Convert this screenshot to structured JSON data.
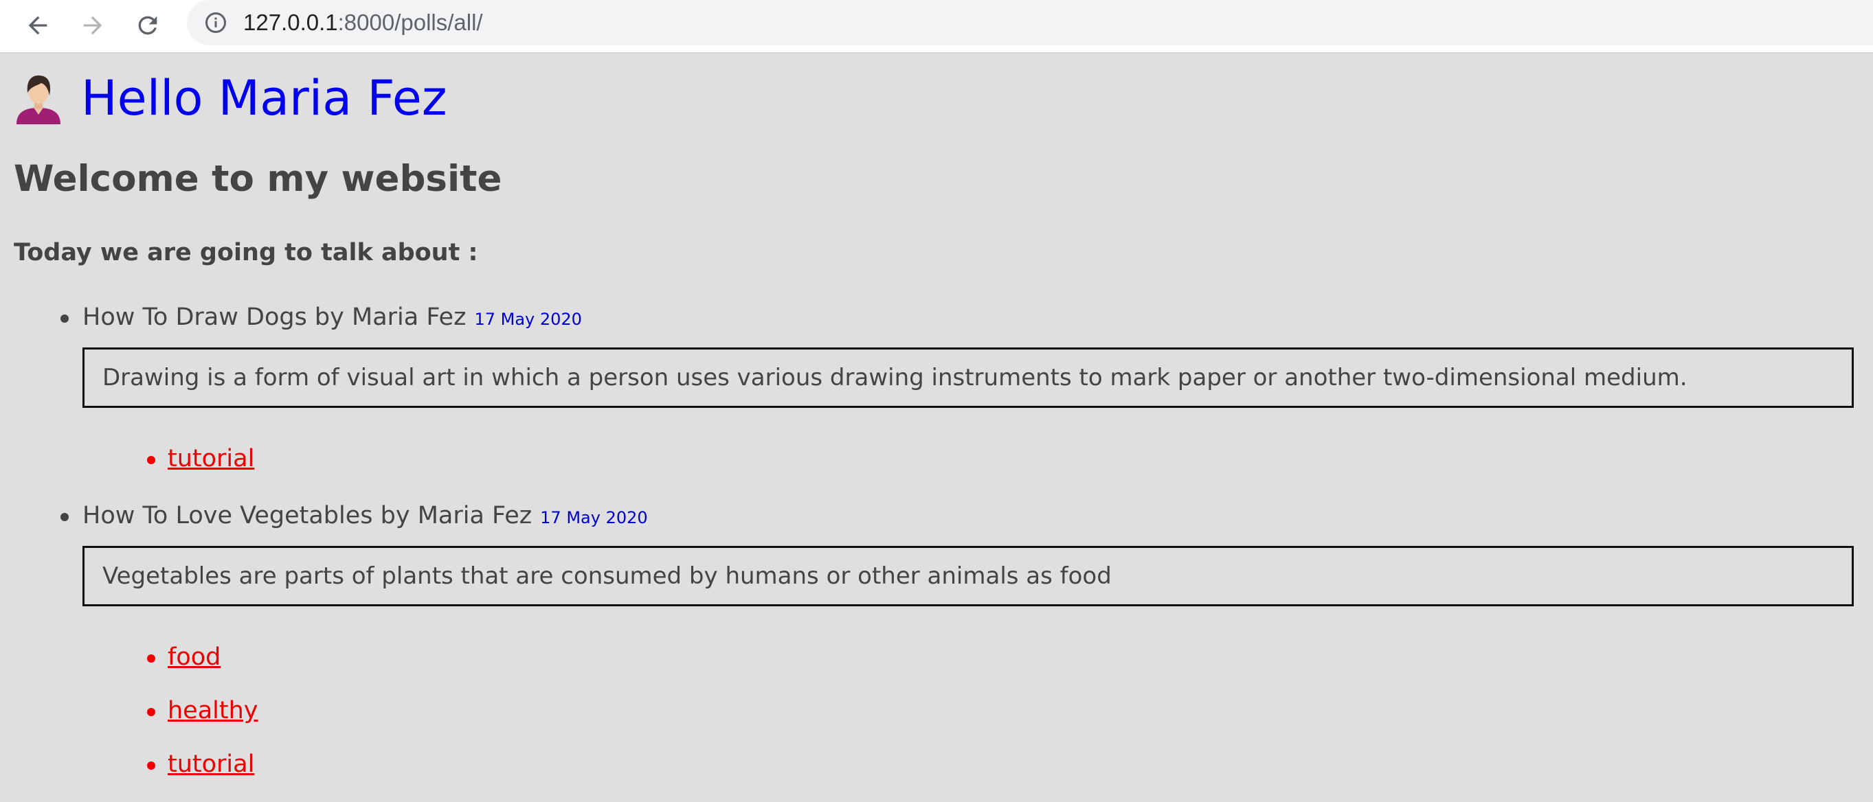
{
  "browser": {
    "url_host": "127.0.0.1",
    "url_path": ":8000/polls/all/",
    "icons": {
      "back": "back-arrow-icon",
      "forward": "forward-arrow-icon",
      "reload": "reload-icon",
      "site_info": "info-icon"
    }
  },
  "page": {
    "greeting": "Hello Maria Fez",
    "welcome": "Welcome to my website",
    "intro": "Today we are going to talk about :",
    "colors": {
      "background": "#dfdfdf",
      "greeting": "#0000ee",
      "date": "#0000cc",
      "tag_link": "#ee0000",
      "text": "#444444"
    },
    "polls": [
      {
        "title": "How To Draw Dogs by Maria Fez",
        "date": "17 May 2020",
        "description": "Drawing is a form of visual art in which a person uses various drawing instruments to mark paper or another two-dimensional medium.",
        "tags": [
          "tutorial"
        ]
      },
      {
        "title": "How To Love Vegetables by Maria Fez",
        "date": "17 May 2020",
        "description": "Vegetables are parts of plants that are consumed by humans or other animals as food",
        "tags": [
          "food",
          "healthy",
          "tutorial"
        ]
      }
    ]
  }
}
